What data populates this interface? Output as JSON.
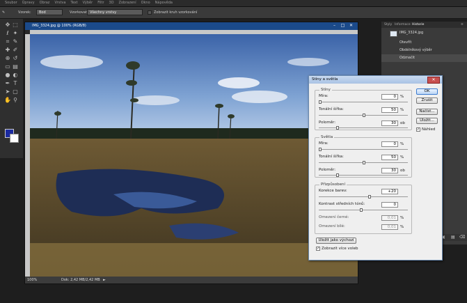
{
  "menu": [
    "Soubor",
    "Úpravy",
    "Obraz",
    "Vrstva",
    "Text",
    "Výběr",
    "Filtr",
    "3D",
    "Zobrazení",
    "Okno",
    "Nápověda"
  ],
  "options": {
    "mode_label": "Vzorek:",
    "mode_value": "Bod",
    "sample_label": "Všechny vrstvy",
    "checkbox_label": "Zobrazit kruh vzorkování"
  },
  "document": {
    "title": "IMG_3324.jpg @ 100% (RGB/8)",
    "zoom": "100%",
    "doc_info": "Dok: 2,42 MB/2,42 MB"
  },
  "history_panel": {
    "tabs": [
      "Styly",
      "Informace",
      "Historie"
    ],
    "rows": [
      "IMG_3324.jpg",
      "Otevřít",
      "Obdélníkový výběr",
      "Odznačit"
    ]
  },
  "dialog": {
    "title": "Stíny a světla",
    "shadows": {
      "title": "Stíny",
      "amount_label": "Míra:",
      "amount_value": "0",
      "amount_unit": "%",
      "tonal_label": "Tonální šířka:",
      "tonal_value": "50",
      "tonal_unit": "%",
      "radius_label": "Poloměr:",
      "radius_value": "30",
      "radius_unit": "ob"
    },
    "highlights": {
      "title": "Světla",
      "amount_label": "Míra:",
      "amount_value": "0",
      "amount_unit": "%",
      "tonal_label": "Tonální šířka:",
      "tonal_value": "50",
      "tonal_unit": "%",
      "radius_label": "Poloměr:",
      "radius_value": "30",
      "radius_unit": "ob"
    },
    "adjustments": {
      "title": "Přizpůsobení",
      "color_label": "Korekce barev:",
      "color_value": "+20",
      "midtone_label": "Kontrast středních tónů:",
      "midtone_value": "0",
      "black_clip_label": "Omezení černé:",
      "black_clip_value": "0,01",
      "black_clip_unit": "%",
      "white_clip_label": "Omezení bílé:",
      "white_clip_value": "0,01",
      "white_clip_unit": "%"
    },
    "buttons": {
      "ok": "OK",
      "cancel": "Zrušit",
      "load": "Načíst...",
      "save": "Uložit..."
    },
    "preview_label": "Náhled",
    "save_default_label": "Uložit jako výchozí",
    "more_options_label": "Zobrazit více voleb"
  },
  "colors": {
    "title_bar": "#1b4a8a",
    "foreground": "#1b2aa0",
    "background": "#ffffff",
    "accent": "#3a7ad0"
  },
  "icons": [
    "move-icon",
    "marquee-icon",
    "lasso-icon",
    "magic-wand-icon",
    "crop-icon",
    "eyedropper-icon",
    "healing-icon",
    "brush-icon",
    "clone-icon",
    "history-brush-icon",
    "eraser-icon",
    "gradient-icon",
    "blur-icon",
    "dodge-icon",
    "pen-icon",
    "text-icon",
    "path-select-icon",
    "shape-icon",
    "hand-icon",
    "zoom-icon"
  ]
}
